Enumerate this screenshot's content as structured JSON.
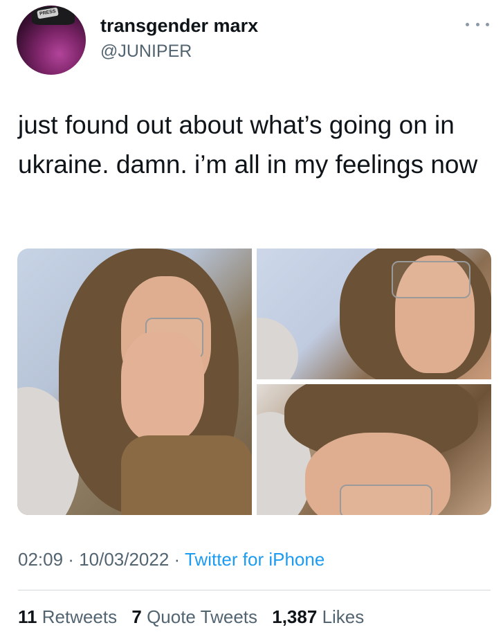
{
  "author": {
    "display_name": "transgender marx",
    "handle": "@JUNIPER",
    "avatar_hat_text": "PRESS"
  },
  "tweet": {
    "text": "just found out about what’s going on in ukraine.  damn.  i’m all in my feelings now",
    "time": "02:09",
    "date": "10/03/2022",
    "source": "Twitter for iPhone",
    "separator": " · "
  },
  "stats": {
    "retweets_count": "11",
    "retweets_label": "Retweets",
    "quotes_count": "7",
    "quotes_label": "Quote Tweets",
    "likes_count": "1,387",
    "likes_label": "Likes"
  },
  "colors": {
    "text": "#0f1419",
    "secondary": "#536471",
    "link": "#1d9bf0",
    "divider": "#cfd9de"
  },
  "icons": {
    "more": "more-horizontal-icon"
  },
  "media": {
    "count": 3
  }
}
